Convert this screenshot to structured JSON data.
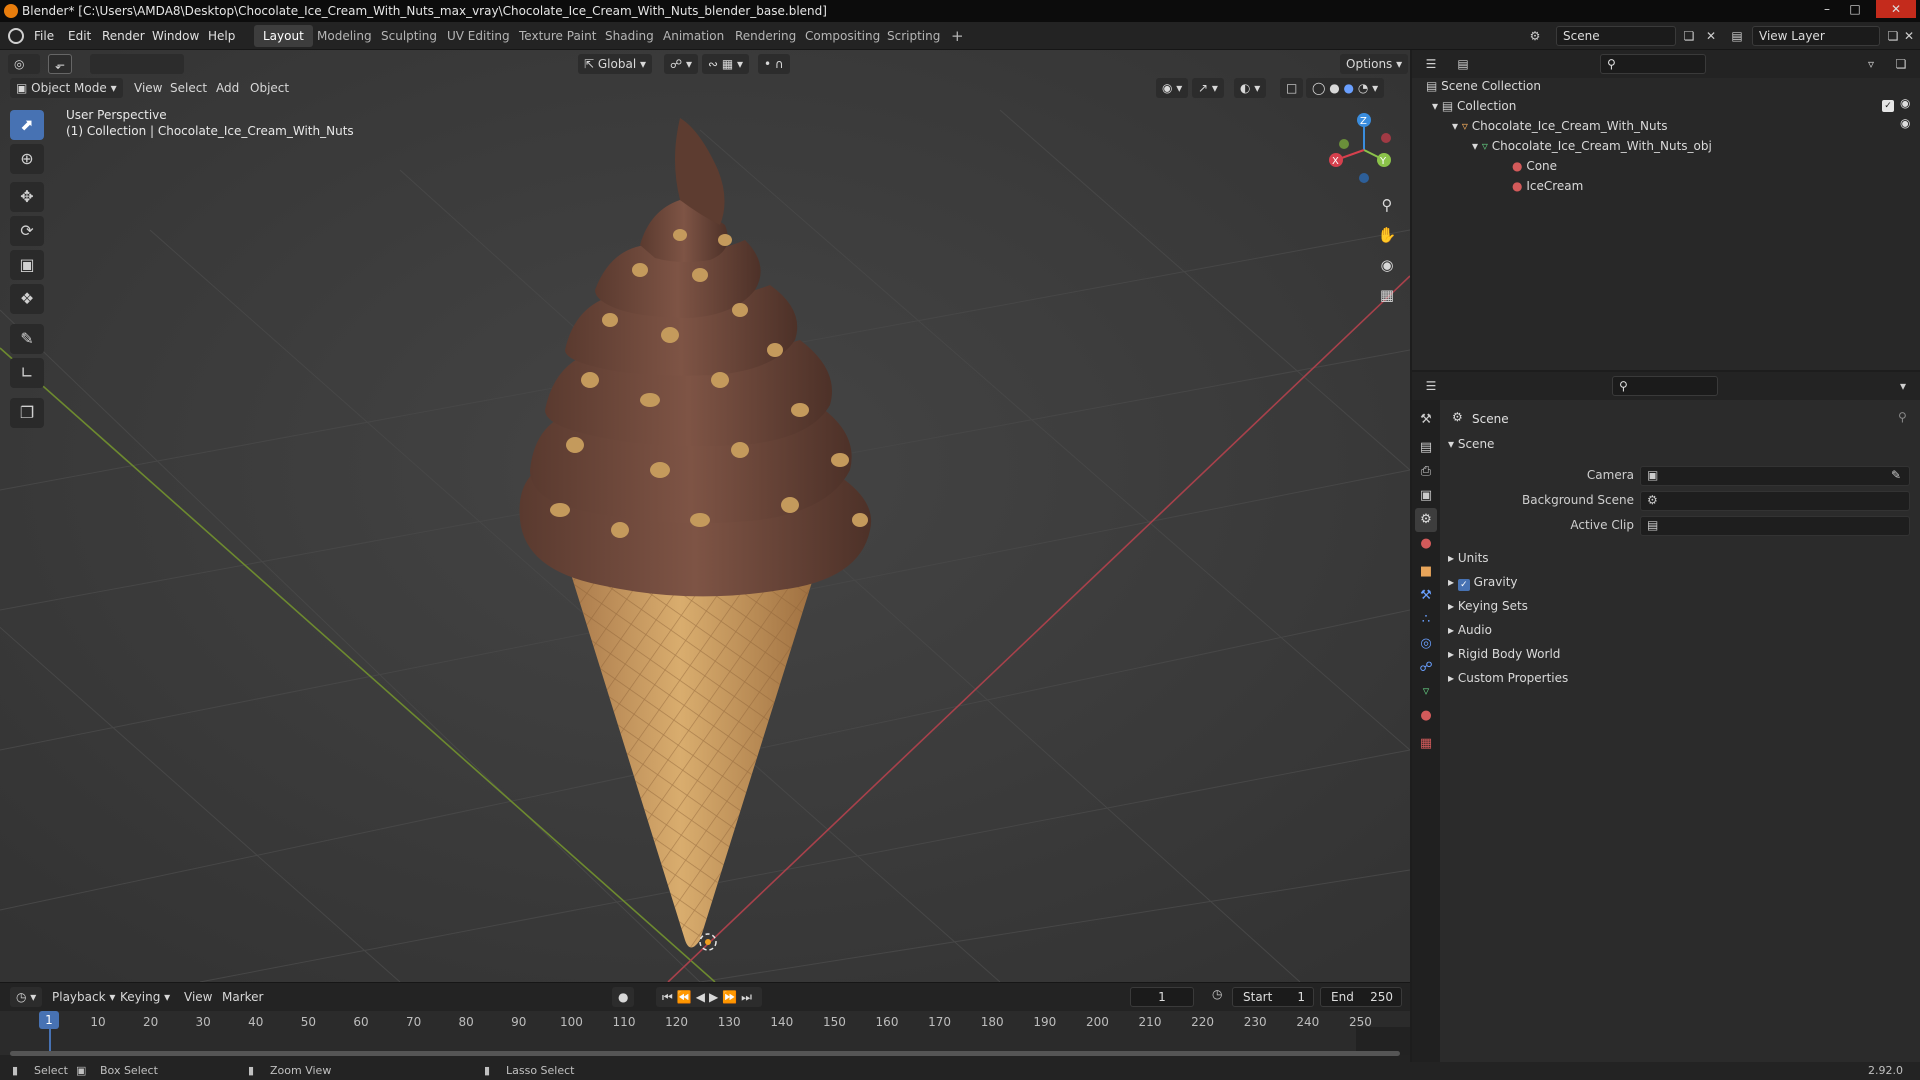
{
  "window": {
    "title": "Blender* [C:\\Users\\AMDA8\\Desktop\\Chocolate_Ice_Cream_With_Nuts_max_vray\\Chocolate_Ice_Cream_With_Nuts_blender_base.blend]"
  },
  "menu": [
    "File",
    "Edit",
    "Render",
    "Window",
    "Help"
  ],
  "workspaces": [
    "Layout",
    "Modeling",
    "Sculpting",
    "UV Editing",
    "Texture Paint",
    "Shading",
    "Animation",
    "Rendering",
    "Compositing",
    "Scripting"
  ],
  "workspace_add": "+",
  "scene_field": "Scene",
  "view_layer_field": "View Layer",
  "viewport": {
    "mode": "Object Mode",
    "menus": [
      "View",
      "Select",
      "Add",
      "Object"
    ],
    "transform_orientation": "Global",
    "options": "Options",
    "overlay_line1": "User Perspective",
    "overlay_line2": "(1) Collection | Chocolate_Ice_Cream_With_Nuts",
    "gizmo": {
      "x": "X",
      "y": "Y",
      "z": "Z"
    }
  },
  "outliner": {
    "rows": [
      {
        "label": "Scene Collection",
        "indent": 0
      },
      {
        "label": "Collection",
        "indent": 1
      },
      {
        "label": "Chocolate_Ice_Cream_With_Nuts",
        "indent": 2
      },
      {
        "label": "Chocolate_Ice_Cream_With_Nuts_obj",
        "indent": 3
      },
      {
        "label": "Cone",
        "indent": 4
      },
      {
        "label": "IceCream",
        "indent": 4
      }
    ]
  },
  "properties": {
    "context": "Scene",
    "section": "Scene",
    "fields": [
      {
        "label": "Camera",
        "value": ""
      },
      {
        "label": "Background Scene",
        "value": ""
      },
      {
        "label": "Active Clip",
        "value": ""
      }
    ],
    "panels": [
      {
        "label": "Units",
        "checkbox": false
      },
      {
        "label": "Gravity",
        "checkbox": true
      },
      {
        "label": "Keying Sets",
        "checkbox": false
      },
      {
        "label": "Audio",
        "checkbox": false
      },
      {
        "label": "Rigid Body World",
        "checkbox": false
      },
      {
        "label": "Custom Properties",
        "checkbox": false
      }
    ]
  },
  "timeline": {
    "menus": [
      "Playback",
      "Keying",
      "View",
      "Marker"
    ],
    "current_frame": "1",
    "start_label": "Start",
    "start": "1",
    "end_label": "End",
    "end": "250",
    "ticks": [
      "1",
      "10",
      "20",
      "30",
      "40",
      "50",
      "60",
      "70",
      "80",
      "90",
      "100",
      "110",
      "120",
      "130",
      "140",
      "150",
      "160",
      "170",
      "180",
      "190",
      "200",
      "210",
      "220",
      "230",
      "240",
      "250"
    ]
  },
  "status": {
    "select": "Select",
    "box_select": "Box Select",
    "zoom_view": "Zoom View",
    "lasso_select": "Lasso Select",
    "version": "2.92.0"
  },
  "colors": {
    "accent": "#4772b3",
    "active_tab": "#3d3d3d",
    "axis_x": "#d6404d",
    "axis_y": "#8bc34a",
    "axis_z": "#3a8dde",
    "chocolate": "#6b4436",
    "cone": "#c79a5a"
  }
}
